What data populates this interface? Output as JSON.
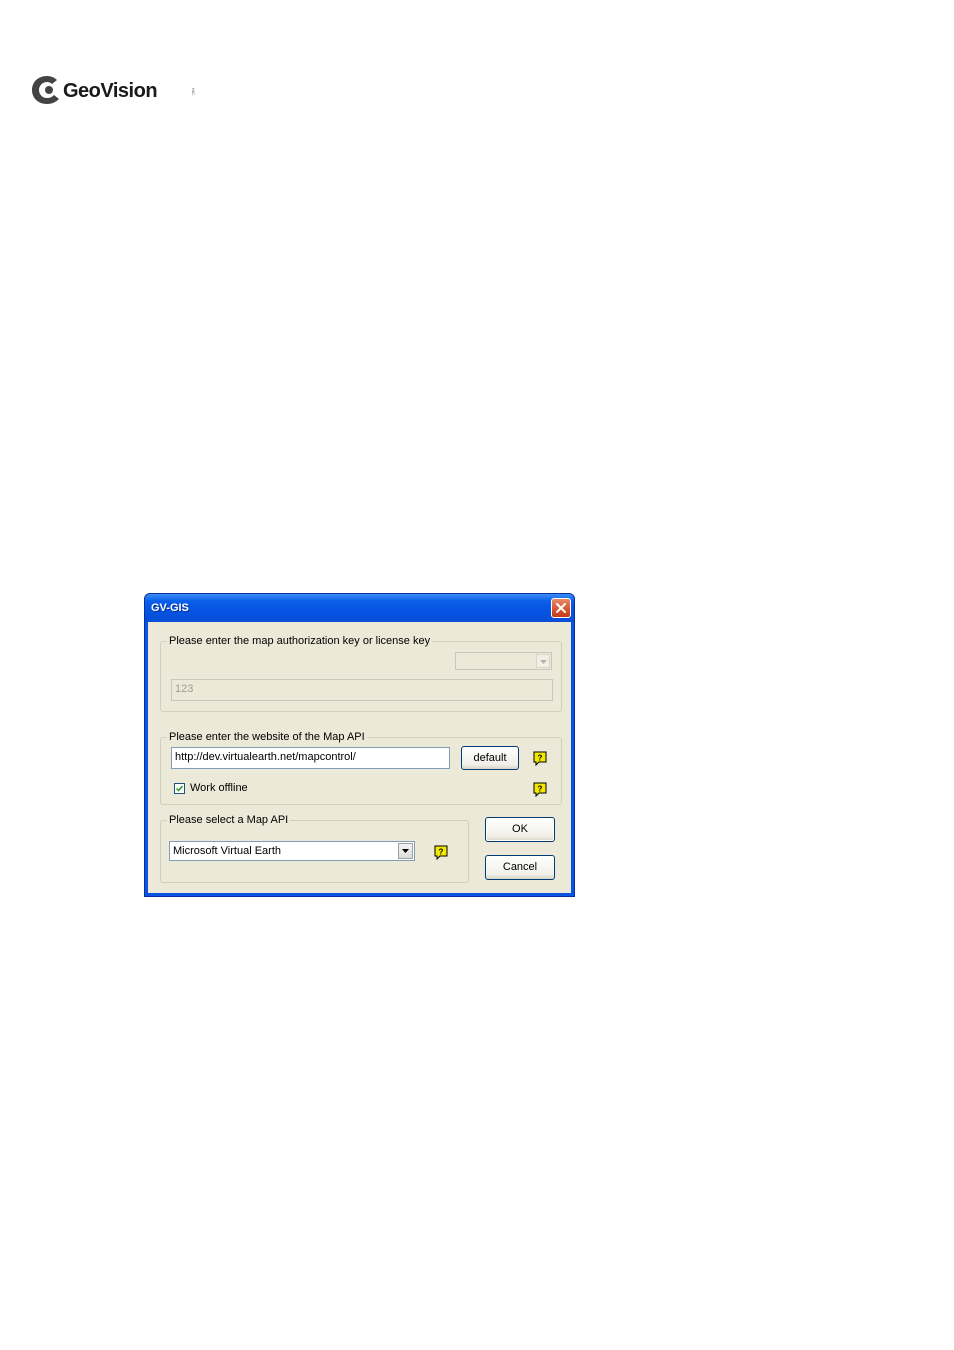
{
  "logo": {
    "text": "GeoVision",
    "tm": "INC."
  },
  "dialog": {
    "title": "GV-GIS",
    "key_group": {
      "legend": "Please enter the map authorization key or license key",
      "key_value": "123"
    },
    "website_group": {
      "legend": "Please enter the website of the Map API",
      "url_value": "http://dev.virtualearth.net/mapcontrol/",
      "default_button": "default",
      "work_offline_label": "Work offline",
      "work_offline_checked": true
    },
    "api_group": {
      "legend": "Please select a Map API",
      "selected_api": "Microsoft Virtual Earth"
    },
    "ok_button": "OK",
    "cancel_button": "Cancel"
  },
  "colors": {
    "titlebar": "#0a54e3",
    "client_bg": "#ece9d8",
    "help_icon": "#f5e800"
  }
}
